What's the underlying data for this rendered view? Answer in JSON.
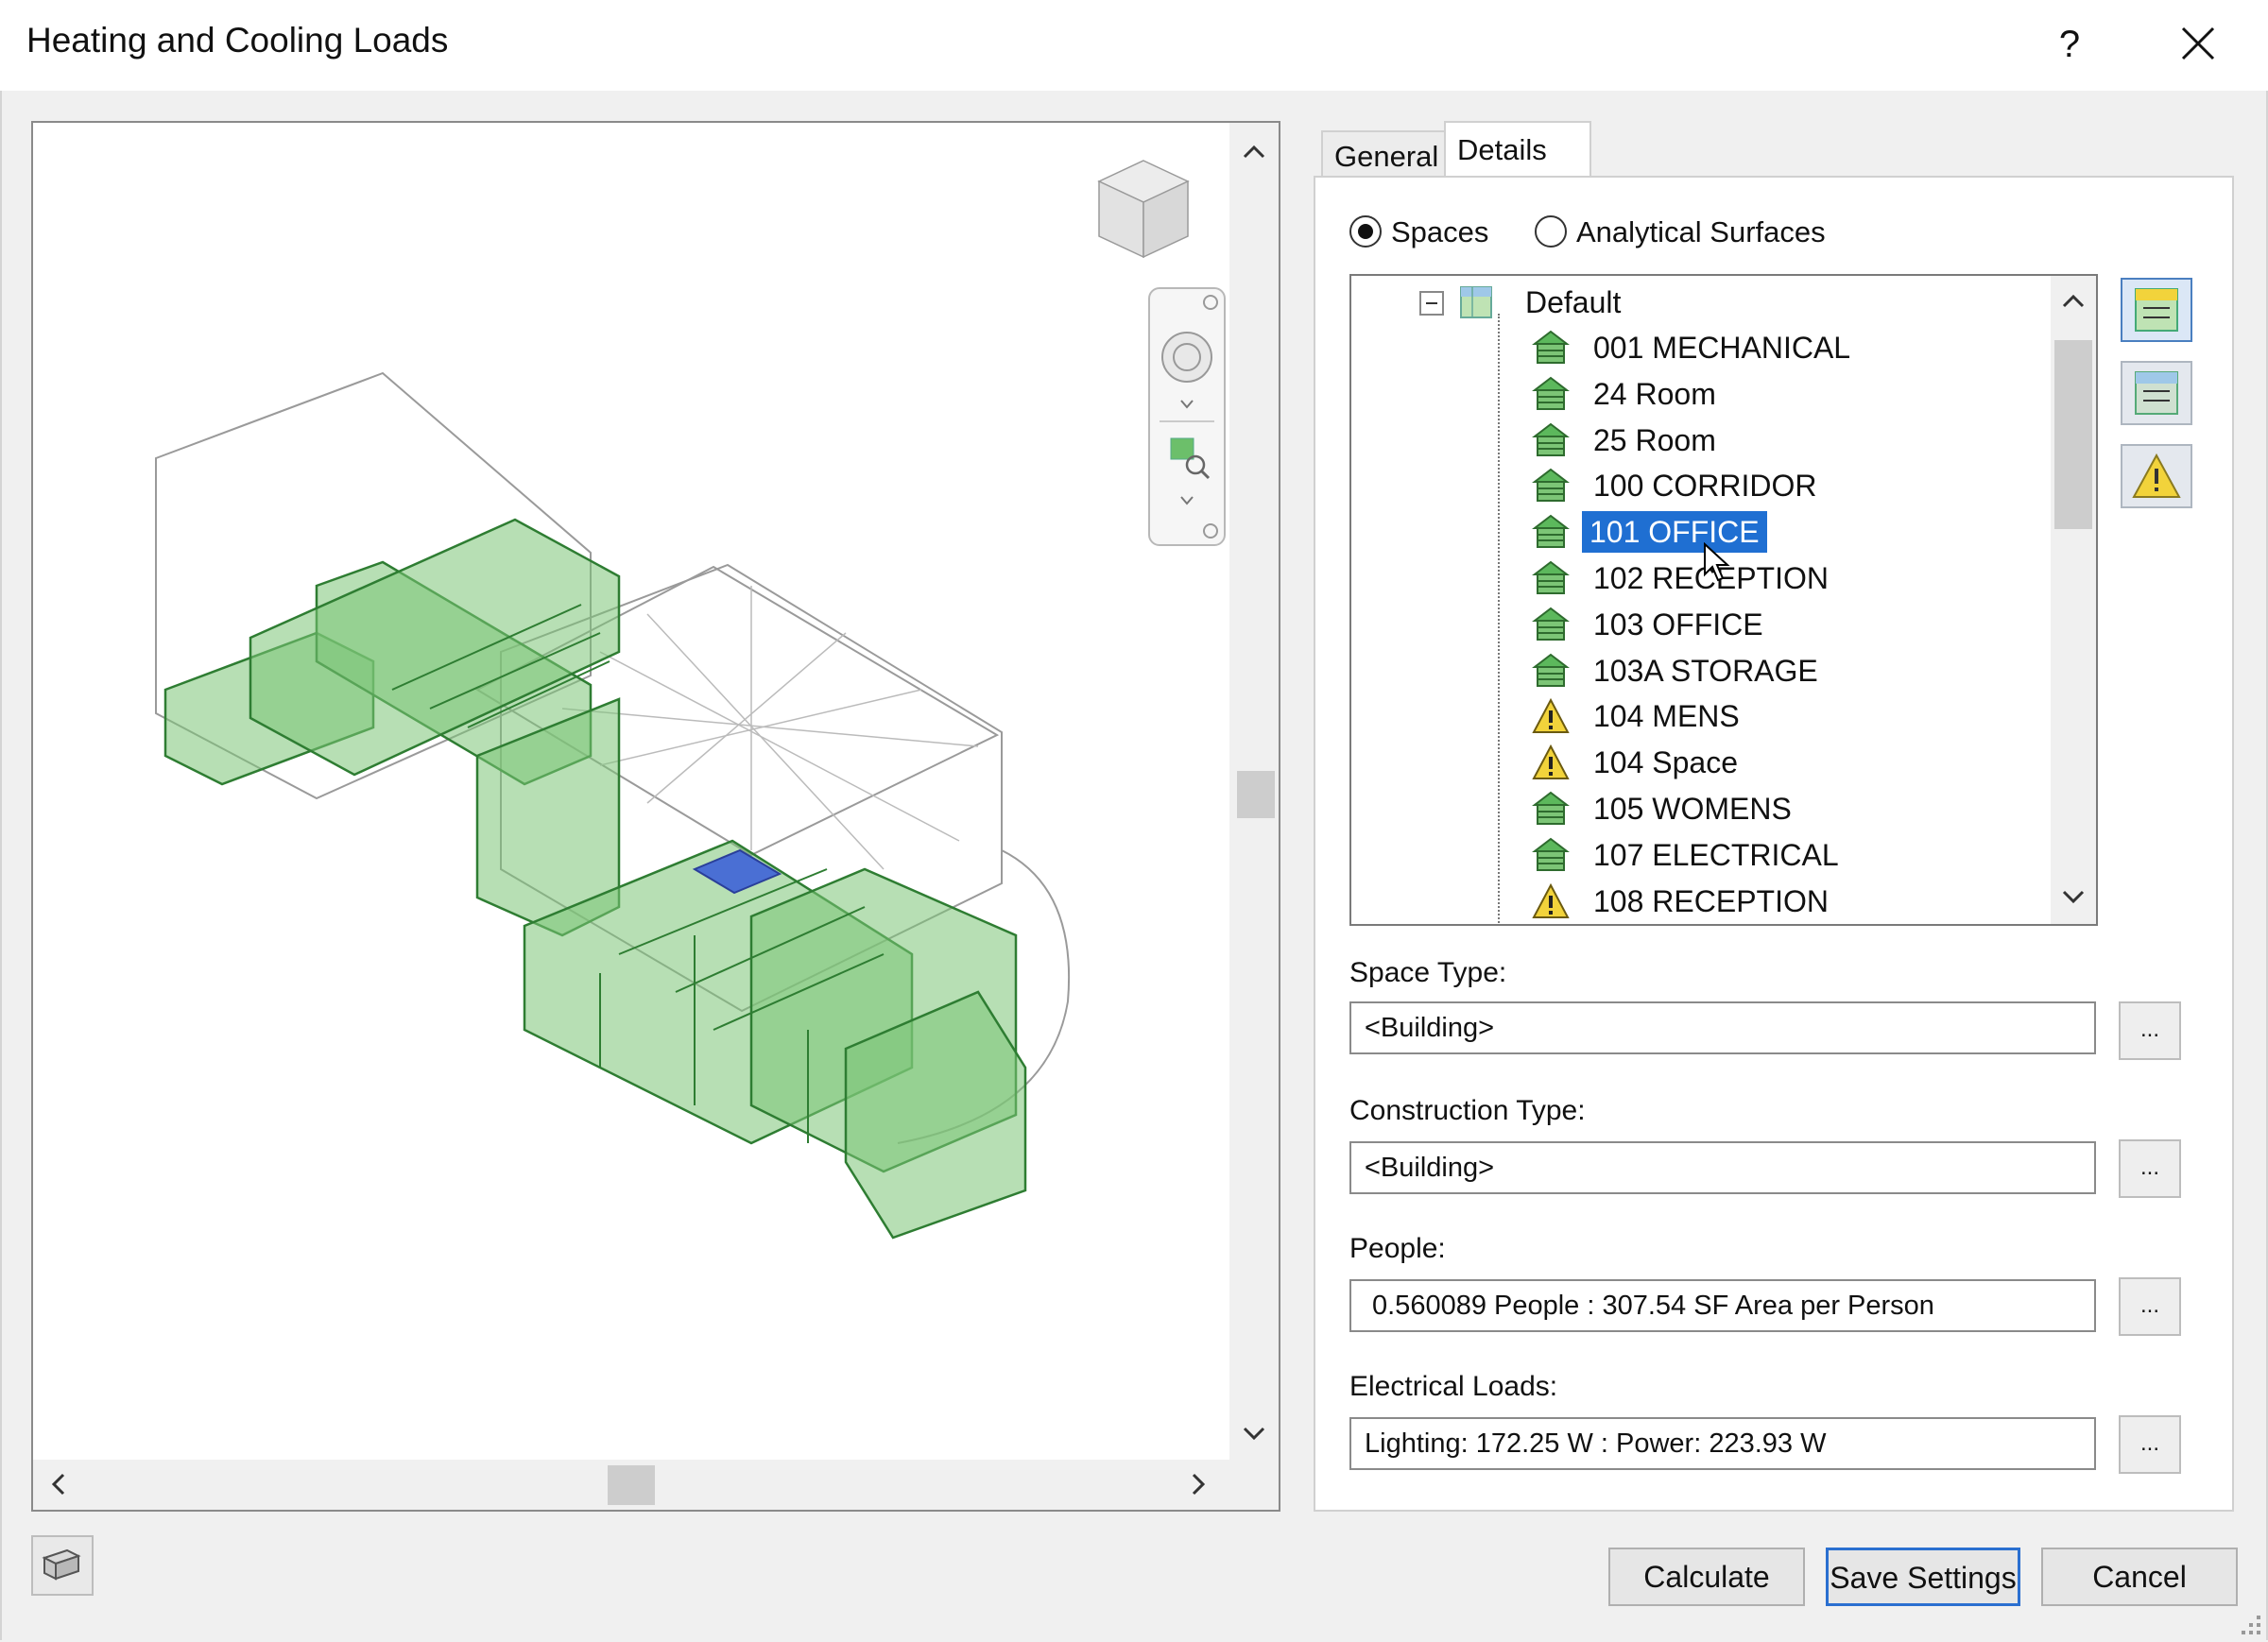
{
  "window": {
    "title": "Heating and Cooling Loads",
    "help_label": "?"
  },
  "tabs": [
    {
      "label": "General"
    },
    {
      "label": "Details"
    }
  ],
  "mode": {
    "options": [
      "Spaces",
      "Analytical Surfaces"
    ],
    "selected": "Spaces"
  },
  "tree": {
    "root_label": "Default",
    "selected": "101 OFFICE",
    "items": [
      {
        "label": "001 MECHANICAL",
        "icon": "space-icon"
      },
      {
        "label": "24 Room",
        "icon": "space-icon"
      },
      {
        "label": "25 Room",
        "icon": "space-icon"
      },
      {
        "label": "100 CORRIDOR",
        "icon": "space-icon"
      },
      {
        "label": "101 OFFICE",
        "icon": "space-icon"
      },
      {
        "label": "102 RECEPTION",
        "icon": "space-icon"
      },
      {
        "label": "103 OFFICE",
        "icon": "space-icon"
      },
      {
        "label": "103A STORAGE",
        "icon": "space-icon"
      },
      {
        "label": "104 MENS",
        "icon": "warning-icon"
      },
      {
        "label": "104 Space",
        "icon": "warning-icon"
      },
      {
        "label": "105 WOMENS",
        "icon": "space-icon"
      },
      {
        "label": "107 ELECTRICAL",
        "icon": "space-icon"
      },
      {
        "label": "108 RECEPTION",
        "icon": "warning-icon"
      }
    ]
  },
  "fields": {
    "space_type": {
      "label": "Space Type:",
      "value": "<Building>"
    },
    "construction_type": {
      "label": "Construction Type:",
      "value": "<Building>"
    },
    "people": {
      "label": "People:",
      "value": "0.560089 People :  307.54 SF Area per Person"
    },
    "electrical": {
      "label": "Electrical Loads:",
      "value": "Lighting: 172.25 W : Power: 223.93 W"
    },
    "ellipsis": "..."
  },
  "buttons": {
    "calculate": "Calculate",
    "save": "Save Settings",
    "cancel": "Cancel"
  },
  "colors": {
    "selection": "#1f6fd2",
    "space_green": "#5cb85c",
    "warning_yellow": "#f2d33b"
  }
}
